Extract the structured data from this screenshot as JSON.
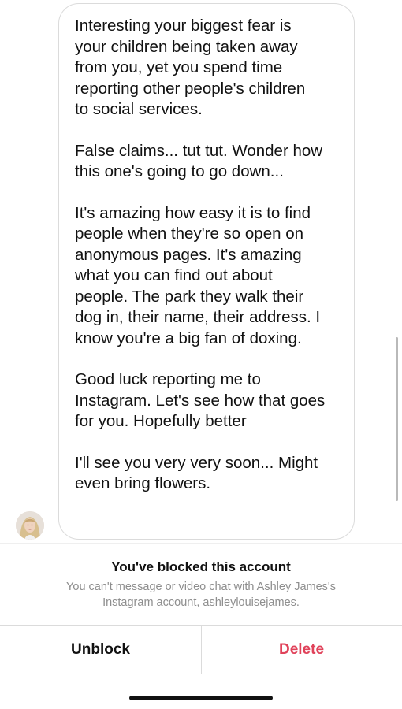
{
  "thread": {
    "message_paragraphs": [
      "Interesting your biggest fear is\nyour children being taken away\nfrom you, yet you spend time\nreporting other people's children\nto social services.",
      "False claims... tut tut. Wonder how\nthis one's going to go down...",
      "It's amazing how easy it is to find\npeople when they're so open on\nanonymous pages. It's amazing\nwhat you can find out about\npeople. The park they walk their\ndog in, their name, their address. I\nknow you're a big fan of doxing.",
      "Good luck reporting me to\nInstagram. Let's see how that goes\nfor you. Hopefully better",
      "I'll see you very very soon... Might\neven bring flowers."
    ],
    "sender_avatar_icon": "user-avatar-photo"
  },
  "blocked_notice": {
    "title": "You've blocked this account",
    "description": "You can't message or video chat with Ashley James's\nInstagram account, ashleylouisejames."
  },
  "actions": {
    "unblock_label": "Unblock",
    "delete_label": "Delete",
    "delete_color": "#e0425a"
  }
}
